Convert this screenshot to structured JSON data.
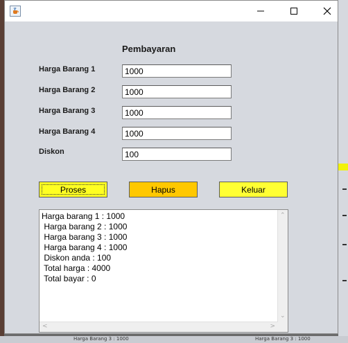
{
  "window": {
    "title": "",
    "icons": {
      "app": "java-cup-icon",
      "minimize": "minimize-icon",
      "maximize": "maximize-icon",
      "close": "close-icon"
    }
  },
  "form": {
    "heading": "Pembayaran",
    "fields": [
      {
        "label": "Harga Barang 1",
        "value": "1000"
      },
      {
        "label": "Harga Barang 2",
        "value": "1000"
      },
      {
        "label": "Harga Barang 3",
        "value": "1000"
      },
      {
        "label": "Harga Barang 4",
        "value": "1000"
      },
      {
        "label": "Diskon",
        "value": "100"
      }
    ]
  },
  "buttons": {
    "proses": "Proses",
    "hapus": "Hapus",
    "keluar": "Keluar"
  },
  "output": {
    "lines": [
      "Harga barang 1 : 1000",
      " Harga barang 2 : 1000",
      " Harga barang 3 : 1000",
      " Harga barang 4 : 1000",
      " Diskon anda : 100",
      " Total harga : 4000",
      " Total bayar : 0"
    ]
  },
  "background": {
    "bottom_text_left": "Harga Barang 3 : 1000",
    "bottom_text_right": "Harga Barang 3 : 1000"
  },
  "colors": {
    "window_bg": "#d6d9df",
    "proses_button": "#ffff22",
    "hapus_button": "#ffc800",
    "keluar_button": "#ffff33"
  }
}
